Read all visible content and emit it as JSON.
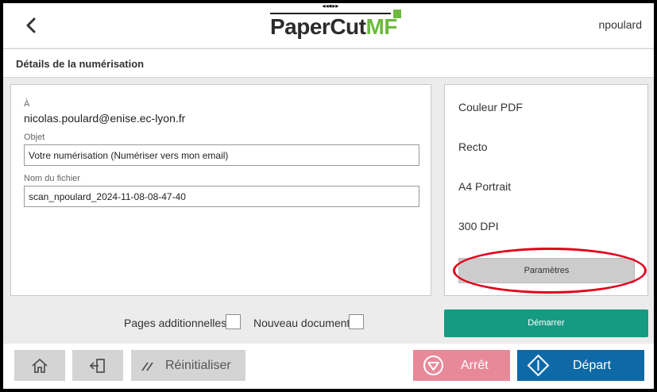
{
  "header": {
    "top_tab": "◂◂●▸▸",
    "logo_main": "PaperCut",
    "logo_accent": "MF",
    "username": "npoulard"
  },
  "subheader": {
    "title": "Détails de la numérisation"
  },
  "form": {
    "to_label": "À",
    "to_value": "nicolas.poulard@enise.ec-lyon.fr",
    "subject_label": "Objet",
    "subject_value": "Votre numérisation (Numériser vers mon email)",
    "filename_label": "Nom du fichier",
    "filename_value": "scan_npoulard_2024-11-08-08-47-40"
  },
  "settings": {
    "color": "Couleur PDF",
    "sides": "Recto",
    "paper": "A4 Portrait",
    "resolution": "300 DPI",
    "params_label": "Paramètres"
  },
  "options": {
    "additional_pages_label": "Pages additionnelles",
    "additional_pages_checked": false,
    "new_document_label": "Nouveau document",
    "new_document_checked": false
  },
  "actions": {
    "start_label": "Démarrer",
    "reset_label": "Réinitialiser",
    "stop_label": "Arrêt",
    "go_label": "Départ"
  },
  "colors": {
    "accent_green": "#169b83",
    "stop_pink": "#e8899a",
    "go_blue": "#0d6aa6",
    "logo_green": "#6cbb3c",
    "highlight_red": "#e3001b"
  },
  "icons": {
    "back": "chevron-left-icon",
    "home": "home-icon",
    "logout": "logout-icon",
    "reset": "reset-slashes-icon",
    "stop": "stop-circle-icon",
    "go": "start-diamond-icon"
  }
}
